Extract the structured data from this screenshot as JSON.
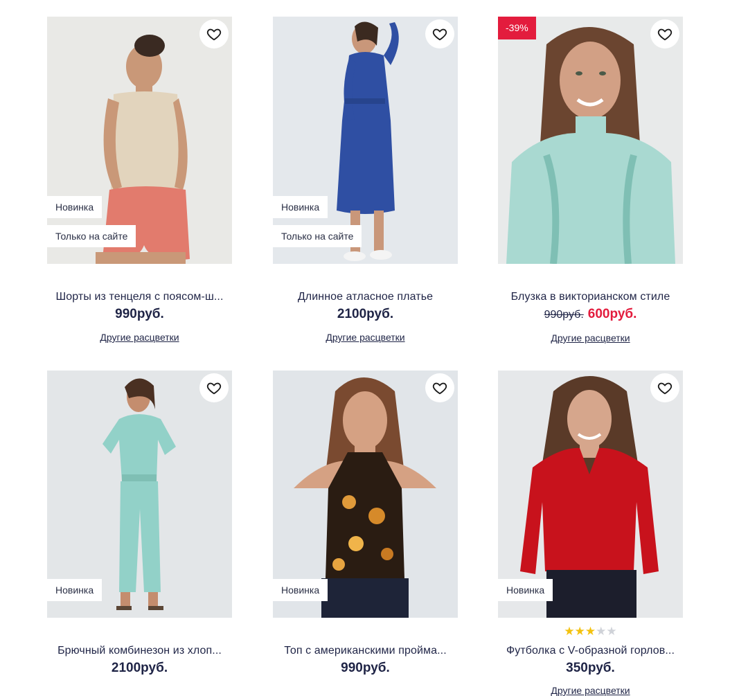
{
  "products": [
    {
      "title": "Шорты из тенцеля с поясом-ш...",
      "tags": [
        "Новинка",
        "Только на сайте"
      ],
      "price": "990руб.",
      "more_colors": "Другие расцветки"
    },
    {
      "title": "Длинное атласное платье",
      "tags": [
        "Новинка",
        "Только на сайте"
      ],
      "price": "2100руб.",
      "more_colors": "Другие расцветки"
    },
    {
      "title": "Блузка в викторианском стиле",
      "discount": "-39%",
      "old_price": "990руб.",
      "new_price": "600руб.",
      "more_colors": "Другие расцветки"
    },
    {
      "title": "Брючный комбинезон из хлоп...",
      "tags": [
        "Новинка"
      ],
      "price": "2100руб."
    },
    {
      "title": "Топ с американскими пройма...",
      "tags": [
        "Новинка"
      ],
      "price": "990руб."
    },
    {
      "title": "Футболка с V-образной горлов...",
      "tags": [
        "Новинка"
      ],
      "rating": 2.5,
      "rating_max": 5,
      "price": "350руб.",
      "more_colors": "Другие расцветки"
    }
  ],
  "icons": {
    "favorite": "heart-outline-icon",
    "rating_star": "star-icon"
  },
  "colors": {
    "text": "#1f2446",
    "sale_red": "#e31c3d",
    "star": "#f3c20f",
    "star_empty": "#cfd2d8"
  }
}
